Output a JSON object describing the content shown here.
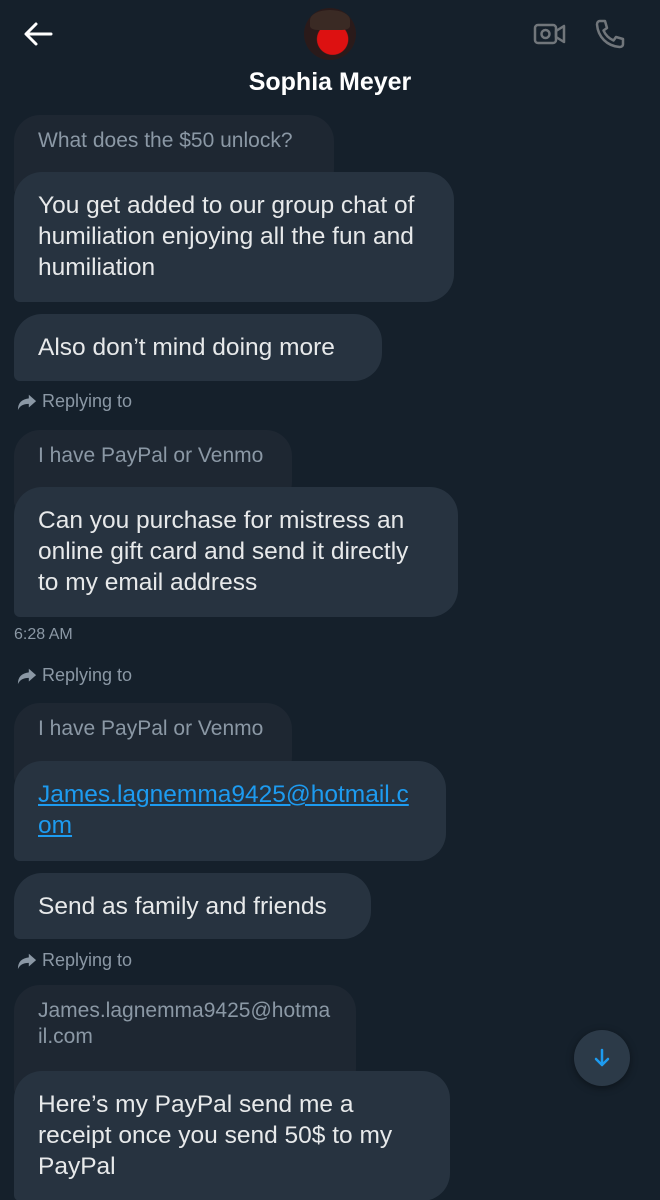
{
  "header": {
    "contact_name": "Sophia Meyer",
    "icons": {
      "back": "arrow-left-icon",
      "video": "video-camera-icon",
      "call": "phone-icon"
    }
  },
  "messages": [
    {
      "type": "quote",
      "text": "What does the $50 unlock?"
    },
    {
      "type": "message",
      "text": "You get added to our group chat of humiliation enjoying all the fun and humiliation"
    },
    {
      "type": "message",
      "text": "Also don’t mind doing more"
    },
    {
      "type": "reply_label",
      "text": "Replying to"
    },
    {
      "type": "quote",
      "text": "I have PayPal or Venmo"
    },
    {
      "type": "message",
      "text": "Can you purchase for mistress an online gift card and send it directly to my email address"
    },
    {
      "type": "timestamp",
      "text": "6:28 AM"
    },
    {
      "type": "reply_label",
      "text": "Replying to"
    },
    {
      "type": "quote",
      "text": "I have PayPal or Venmo"
    },
    {
      "type": "message_link",
      "text": "James.lagnemma9425@hotmail.com"
    },
    {
      "type": "message",
      "text": "Send as family and friends"
    },
    {
      "type": "reply_label",
      "text": "Replying to"
    },
    {
      "type": "quote",
      "text": "James.lagnemma9425@hotmail.com"
    },
    {
      "type": "message",
      "text": "Here’s my PayPal send me a receipt once you send 50$ to my PayPal"
    }
  ],
  "colors": {
    "background": "#15202b",
    "bubble": "#273340",
    "quote": "#1e2732",
    "link": "#1d9bf0",
    "muted_text": "#8b98a5"
  },
  "scroll_button": {
    "icon": "arrow-down-icon"
  }
}
